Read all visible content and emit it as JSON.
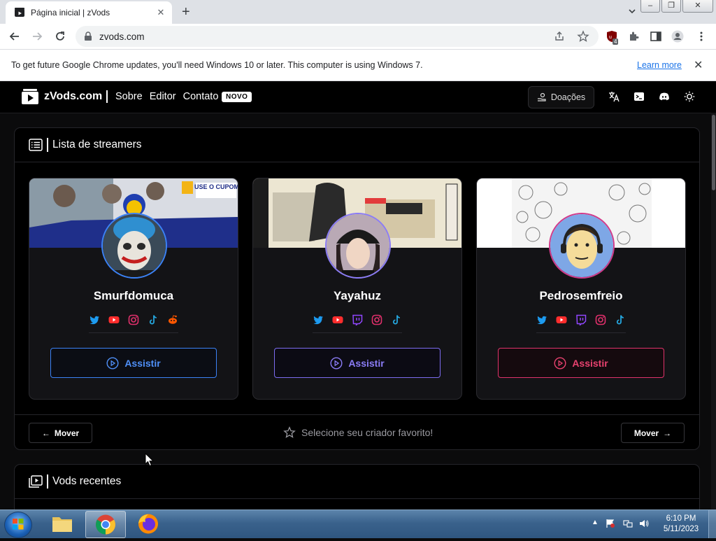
{
  "browser": {
    "tab_title": "Página inicial | zVods",
    "url": "zvods.com",
    "ext_badge": "4",
    "infobar_text": "To get future Google Chrome updates, you'll need Windows 10 or later. This computer is using Windows 7.",
    "infobar_link": "Learn more"
  },
  "site": {
    "logo": "zVods.com",
    "nav": [
      "Sobre",
      "Editor",
      "Contato"
    ],
    "new_badge": "NOVO",
    "donate_label": "Doações"
  },
  "streamers_panel": {
    "title": "Lista de streamers",
    "cards": [
      {
        "name": "Smurfdomuca",
        "socials": [
          "twitter-icon",
          "youtube-icon",
          "instagram-icon",
          "tiktok-icon",
          "reddit-icon"
        ],
        "watch_label": "Assistir",
        "accent": "#3b82f6"
      },
      {
        "name": "Yayahuz",
        "socials": [
          "twitter-icon",
          "youtube-icon",
          "twitch-icon",
          "instagram-icon",
          "tiktok-icon"
        ],
        "watch_label": "Assistir",
        "accent": "#7c6cf0"
      },
      {
        "name": "Pedrosemfreio",
        "socials": [
          "twitter-icon",
          "youtube-icon",
          "twitch-icon",
          "instagram-icon",
          "tiktok-icon"
        ],
        "watch_label": "Assistir",
        "accent": "#e0336b"
      }
    ],
    "banner_text": "USE O CUPOM",
    "prev_label": "Mover",
    "next_label": "Mover",
    "favorite_hint": "Selecione seu criador favorito!"
  },
  "vods_panel": {
    "title": "Vods recentes"
  },
  "taskbar": {
    "time": "6:10 PM",
    "date": "5/11/2023"
  },
  "colors": {
    "twitter": "#1d9bf0",
    "youtube": "#ff2d2d",
    "instagram": "#e1306c",
    "twitch": "#9146ff",
    "tiktok": "#25a8e0",
    "reddit": "#ff5700"
  }
}
